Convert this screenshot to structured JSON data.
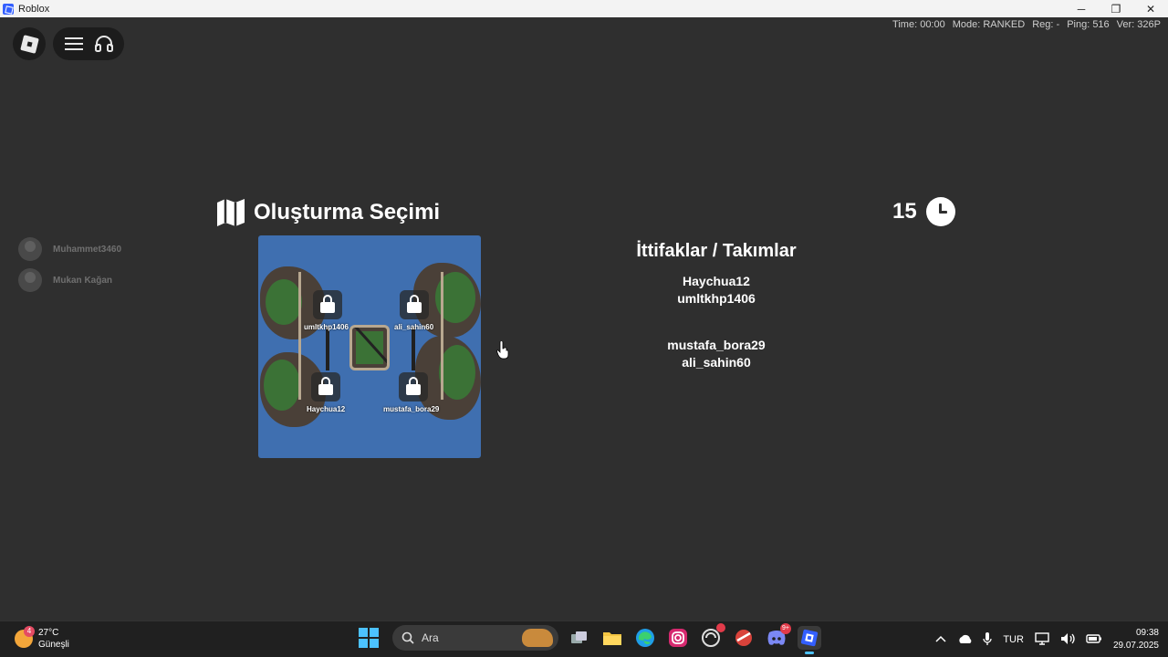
{
  "window": {
    "title": "Roblox",
    "minimize": "─",
    "restore": "❐",
    "close": "✕"
  },
  "stats": {
    "time": "Time: 00:00",
    "mode": "Mode: RANKED",
    "reg": "Reg: -",
    "ping": "Ping: 516",
    "ver": "Ver: 326P"
  },
  "players": [
    {
      "name": "Muhammet3460"
    },
    {
      "name": "Mukan Kağan"
    }
  ],
  "header": {
    "title": "Oluşturma Seçimi",
    "timer": "15"
  },
  "map": {
    "labels": [
      "umltkhp1406",
      "ali_sahin60",
      "Haychua12",
      "mustafa_bora29"
    ]
  },
  "teams": {
    "title": "İttifaklar / Takımlar",
    "groups": [
      [
        "Haychua12",
        "umltkhp1406"
      ],
      [
        "mustafa_bora29",
        "ali_sahin60"
      ]
    ]
  },
  "taskbar": {
    "weather_temp": "27°C",
    "weather_desc": "Güneşli",
    "weather_badge": "4",
    "search_placeholder": "Ara",
    "discord_badge": "9+",
    "lang": "TUR",
    "time": "09:38",
    "date": "29.07.2025"
  },
  "colors": {
    "background": "#2f2f2f",
    "water": "#3f6fb0",
    "accent": "#4cc2ff"
  }
}
